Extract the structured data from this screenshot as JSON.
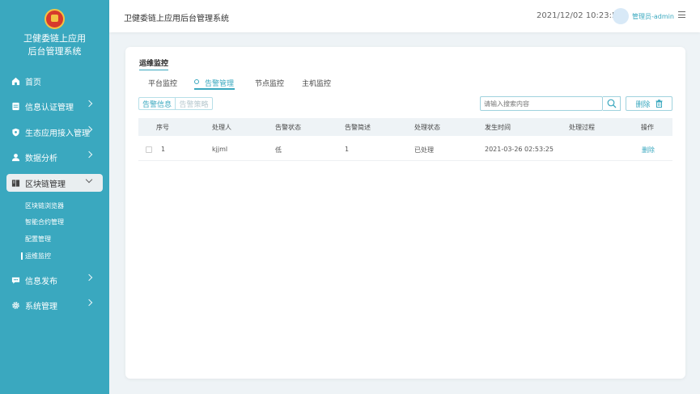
{
  "app": {
    "brand_line1": "卫健委链上应用",
    "brand_line2": "后台管理系统",
    "header_title": "卫健委链上应用后台管理系统",
    "datetime": "2021/12/02 10:23:57",
    "user": "管理员-admin"
  },
  "sidebar": {
    "items": [
      {
        "label": "首页",
        "icon": "home-icon"
      },
      {
        "label": "信息认证管理",
        "icon": "document-icon"
      },
      {
        "label": "生态应用接入管理",
        "icon": "shield-icon"
      },
      {
        "label": "数据分析",
        "icon": "user-icon"
      },
      {
        "label": "区块链管理",
        "icon": "book-icon"
      },
      {
        "label": "信息发布",
        "icon": "chat-icon"
      },
      {
        "label": "系统管理",
        "icon": "gear-icon"
      }
    ],
    "subitems": [
      "区块链浏览器",
      "智能合约管理",
      "配置管理",
      "运维监控"
    ]
  },
  "main": {
    "section_title": "运维监控",
    "tabs": [
      "平台监控",
      "告警管理",
      "节点监控",
      "主机监控"
    ],
    "active_tab": "告警管理",
    "segment": {
      "info": "告警信息",
      "strategy": "告警策略"
    },
    "search_placeholder": "请输入搜索内容",
    "delete_label": "删除",
    "columns": [
      "序号",
      "处理人",
      "告警状态",
      "告警简述",
      "处理状态",
      "发生时间",
      "处理过程",
      "操作"
    ],
    "rows": [
      {
        "no": "1",
        "handler": "kjjml",
        "alert_status": "低",
        "summary": "1",
        "process_status": "已处理",
        "time": "2021-03-26 02:53:25",
        "process": "",
        "action": "删除"
      }
    ]
  },
  "colors": {
    "accent": "#3aa8bf",
    "sidebar_bg": "#3aa8bf",
    "page_bg": "#eef3f6"
  }
}
